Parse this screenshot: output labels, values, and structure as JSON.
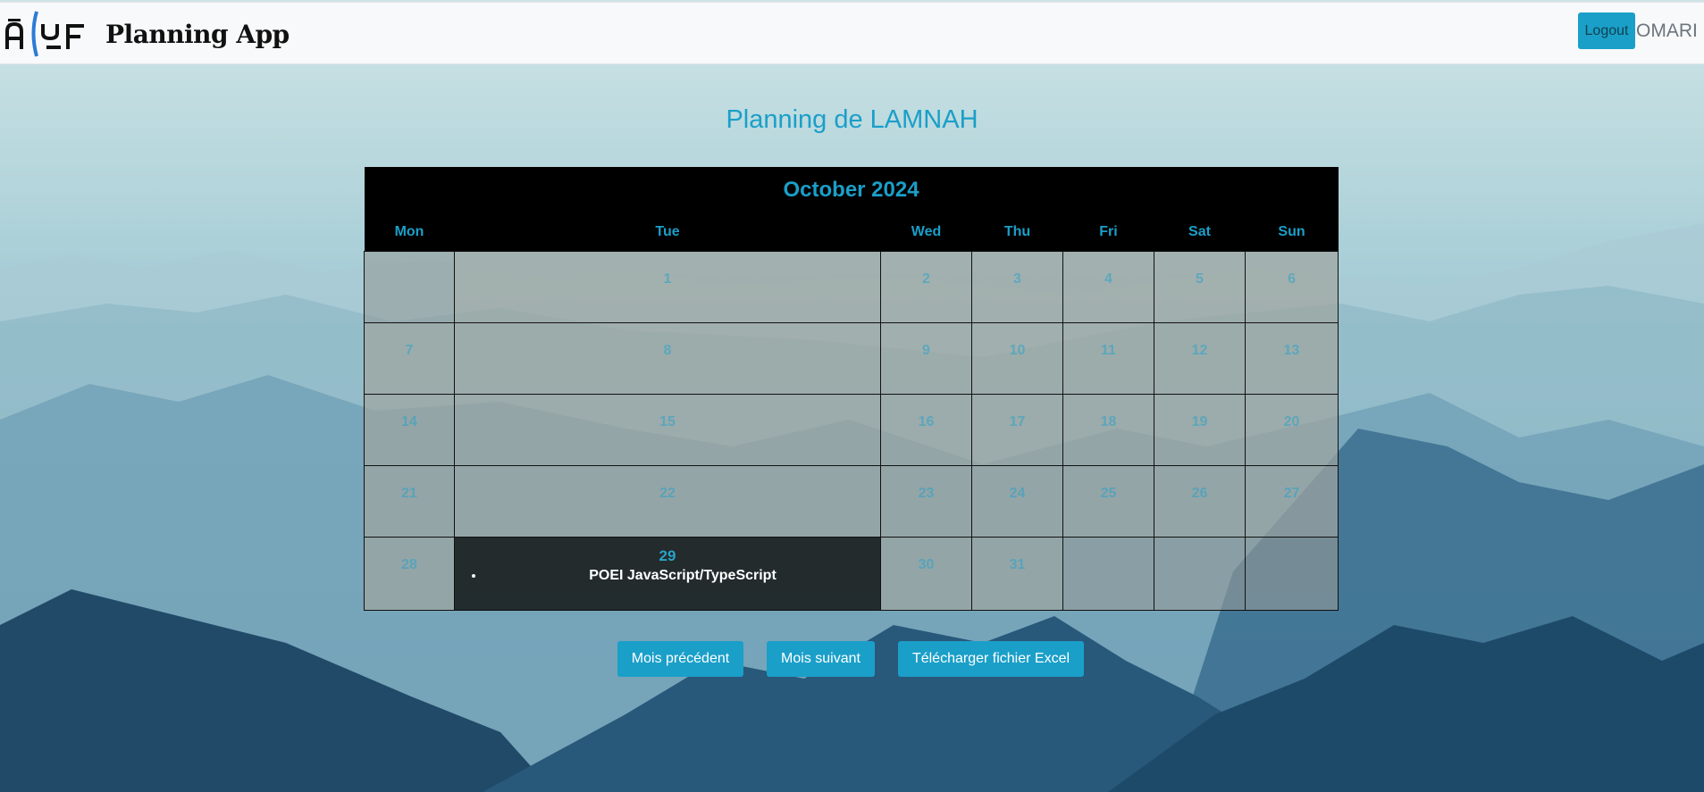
{
  "navbar": {
    "brand_text": "Planning App",
    "logo_alt": "AYF",
    "logout_label": "Logout",
    "username": "OMARI"
  },
  "page": {
    "title": "Planning de LAMNAH"
  },
  "calendar": {
    "month_label": "October 2024",
    "weekdays": [
      "Mon",
      "Tue",
      "Wed",
      "Thu",
      "Fri",
      "Sat",
      "Sun"
    ],
    "weeks": [
      [
        "",
        "1",
        "2",
        "3",
        "4",
        "5",
        "6"
      ],
      [
        "7",
        "8",
        "9",
        "10",
        "11",
        "12",
        "13"
      ],
      [
        "14",
        "15",
        "16",
        "17",
        "18",
        "19",
        "20"
      ],
      [
        "21",
        "22",
        "23",
        "24",
        "25",
        "26",
        "27"
      ],
      [
        "28",
        "29",
        "30",
        "31",
        "",
        "",
        ""
      ]
    ],
    "event_day": "29",
    "event_title": "POEI JavaScript/TypeScript"
  },
  "actions": {
    "prev_label": "Mois précédent",
    "next_label": "Mois suivant",
    "excel_label": "Télécharger fichier Excel"
  },
  "colors": {
    "accent": "#1a9fc9",
    "header_bg": "#000000",
    "navbar_bg": "#f8f9fa"
  }
}
